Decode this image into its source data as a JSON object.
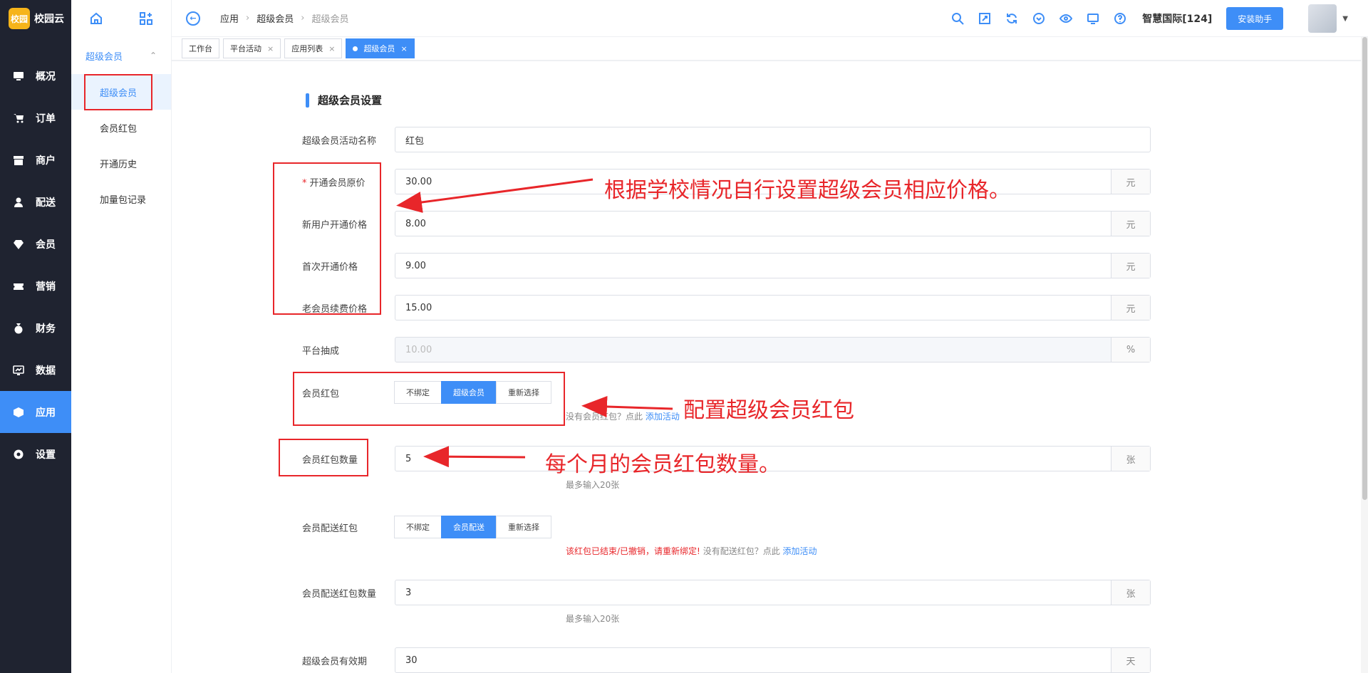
{
  "app": {
    "logo_mark": "校园",
    "logo_text": "校园云"
  },
  "nav": [
    {
      "label": "概况",
      "icon": "monitor-icon"
    },
    {
      "label": "订单",
      "icon": "cart-icon"
    },
    {
      "label": "商户",
      "icon": "store-icon"
    },
    {
      "label": "配送",
      "icon": "courier-icon"
    },
    {
      "label": "会员",
      "icon": "diamond-icon"
    },
    {
      "label": "营销",
      "icon": "ticket-icon"
    },
    {
      "label": "财务",
      "icon": "moneybag-icon"
    },
    {
      "label": "数据",
      "icon": "chart-icon"
    },
    {
      "label": "应用",
      "icon": "cube-icon",
      "active": true
    },
    {
      "label": "设置",
      "icon": "gear-icon"
    }
  ],
  "subnav": {
    "group": "超级会员",
    "items": [
      "超级会员",
      "会员红包",
      "开通历史",
      "加量包记录"
    ]
  },
  "breadcrumb": [
    "应用",
    "超级会员",
    "超级会员"
  ],
  "header": {
    "school": "智慧国际[124]",
    "install_btn": "安装助手"
  },
  "tabs": [
    "工作台",
    "平台活动",
    "应用列表",
    "超级会员"
  ],
  "form": {
    "title": "超级会员设置",
    "name_label": "超级会员活动名称",
    "name_value": "红包",
    "orig_price_label": "开通会员原价",
    "orig_price_value": "30.00",
    "new_user_label": "新用户开通价格",
    "new_user_value": "8.00",
    "first_label": "首次开通价格",
    "first_value": "9.00",
    "renew_label": "老会员续费价格",
    "renew_value": "15.00",
    "platform_label": "平台抽成",
    "platform_value": "10.00",
    "unit_yuan": "元",
    "unit_percent": "%",
    "unit_zhang": "张",
    "unit_tian": "天",
    "redpack_label": "会员红包",
    "redpack_opts": [
      "不绑定",
      "超级会员",
      "重新选择"
    ],
    "redpack_helper": "没有会员红包？点此",
    "add_activity": "添加活动",
    "redpack_count_label": "会员红包数量",
    "redpack_count_value": "5",
    "max_hint": "最多输入20张",
    "delivery_label": "会员配送红包",
    "delivery_opts": [
      "不绑定",
      "会员配送",
      "重新选择"
    ],
    "delivery_warn": "该红包已结束/已撤销，请重新绑定!",
    "delivery_helper": "没有配送红包？点此",
    "delivery_count_label": "会员配送红包数量",
    "delivery_count_value": "3",
    "validity_label": "超级会员有效期",
    "validity_value": "30"
  },
  "annotations": {
    "price": "根据学校情况自行设置超级会员相应价格。",
    "redpack": "配置超级会员红包",
    "count": "每个月的会员红包数量。"
  }
}
